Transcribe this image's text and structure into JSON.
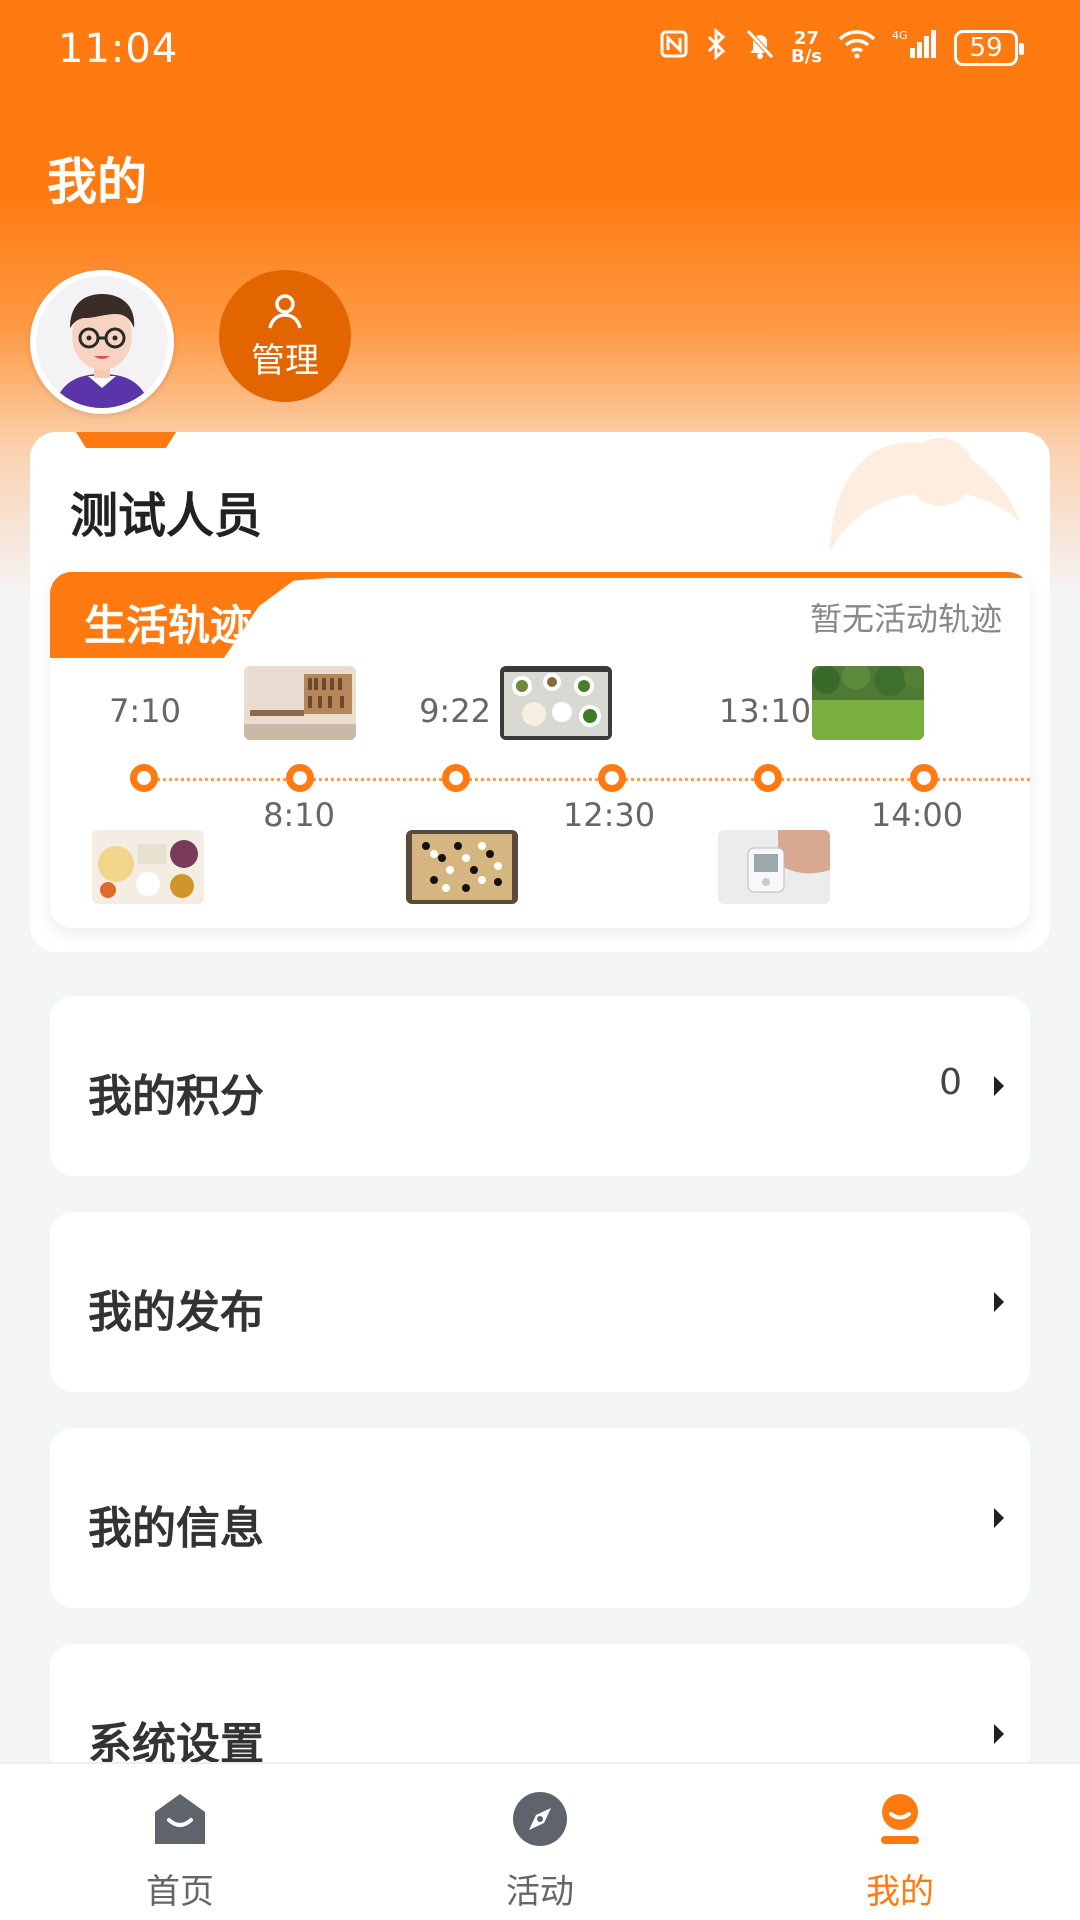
{
  "status_bar": {
    "time": "11:04",
    "net_speed_top": "27",
    "net_speed_bottom": "B/s",
    "network": "4G",
    "battery": "59",
    "icons": [
      "nfc-icon",
      "bluetooth-icon",
      "silent-bell-icon",
      "wifi-icon",
      "signal-icon",
      "battery-icon"
    ]
  },
  "header": {
    "title": "我的"
  },
  "profile": {
    "manage_label": "管理",
    "user_name": "测试人员"
  },
  "trail": {
    "tag": "生活轨迹",
    "empty_text": "暂无活动轨迹",
    "times": [
      "7:10",
      "8:10",
      "9:22",
      "12:30",
      "13:10",
      "14:00"
    ],
    "image_subjects": [
      "breakfast-photo",
      "library-photo",
      "go-board-photo",
      "meal-photo",
      "blood-pressure-photo",
      "park-photo"
    ]
  },
  "menu": [
    {
      "label": "我的积分",
      "value": "0"
    },
    {
      "label": "我的发布",
      "value": ""
    },
    {
      "label": "我的信息",
      "value": ""
    },
    {
      "label": "系统设置",
      "value": ""
    }
  ],
  "bottom_nav": [
    {
      "label": "首页",
      "icon": "home-icon",
      "active": false
    },
    {
      "label": "活动",
      "icon": "compass-icon",
      "active": false
    },
    {
      "label": "我的",
      "icon": "profile-icon",
      "active": true
    }
  ],
  "colors": {
    "accent": "#ff7a10",
    "accent_dark": "#e36500",
    "background": "#f4f5f7"
  }
}
